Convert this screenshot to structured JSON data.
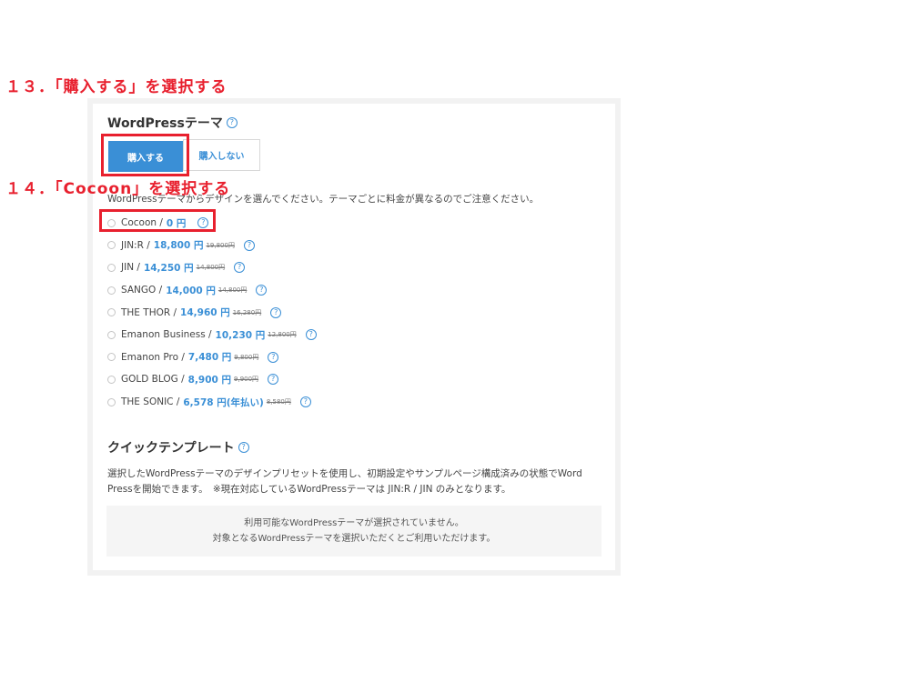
{
  "annotations": {
    "step13": "１３．「購入する」を選択する",
    "step14": "１４．「Cocoon」を選択する"
  },
  "theme_section": {
    "title": "WordPressテーマ",
    "buy_label": "購入する",
    "no_buy_label": "購入しない",
    "description": "WordPressテーマからデザインを選んでください。テーマごとに料金が異なるのでご注意ください。",
    "options": [
      {
        "name": "Cocoon /",
        "price": "0 円",
        "old_price": ""
      },
      {
        "name": "JIN:R /",
        "price": "18,800 円",
        "old_price": "19,800円"
      },
      {
        "name": "JIN /",
        "price": "14,250 円",
        "old_price": "14,800円"
      },
      {
        "name": "SANGO /",
        "price": "14,000 円",
        "old_price": "14,800円"
      },
      {
        "name": "THE THOR /",
        "price": "14,960 円",
        "old_price": "16,280円"
      },
      {
        "name": "Emanon Business /",
        "price": "10,230 円",
        "old_price": "12,800円"
      },
      {
        "name": "Emanon Pro /",
        "price": "7,480 円",
        "old_price": "9,800円"
      },
      {
        "name": "GOLD BLOG /",
        "price": "8,900 円",
        "old_price": "9,900円"
      },
      {
        "name": "THE SONIC /",
        "price": "6,578 円(年払い)",
        "old_price": "8,580円"
      }
    ]
  },
  "quick_template": {
    "title": "クイックテンプレート",
    "line1": "選択したWordPressテーマのデザインプリセットを使用し、初期設定やサンプルページ構成済みの状態でWord",
    "line2": "Pressを開始できます。　※現在対応しているWordPressテーマは JIN:R / JIN のみとなります。",
    "notice1": "利用可能なWordPressテーマが選択されていません。",
    "notice2": "対象となるWordPressテーマを選択いただくとご利用いただけます。"
  },
  "help_icon_text": "?",
  "colors": {
    "accent": "#3a8fd6",
    "annotation": "#e8202e"
  }
}
